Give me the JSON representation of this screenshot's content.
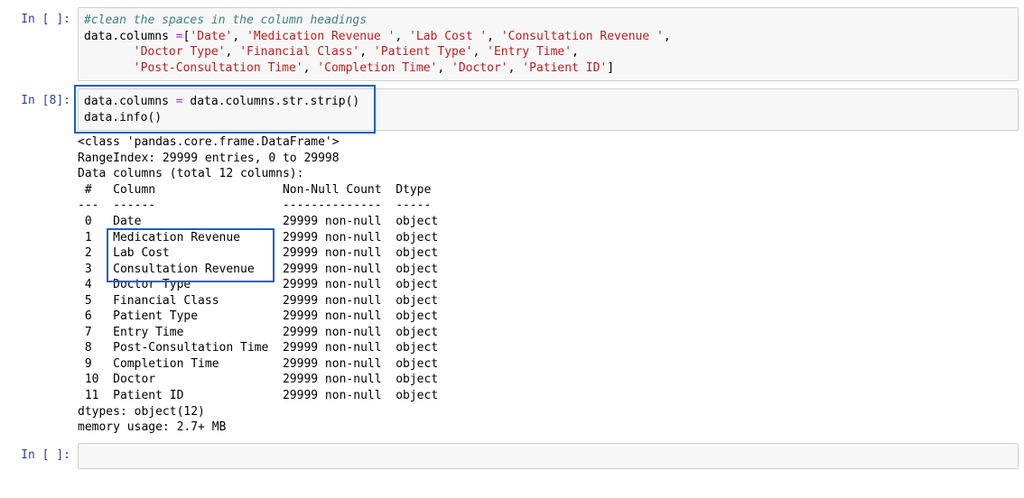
{
  "cell1": {
    "prompt": "In [ ]:",
    "code": {
      "comment": "#clean the spaces in the column headings",
      "assign_prefix": "data.columns =[",
      "cols_line1": [
        "'Date'",
        "'Medication Revenue '",
        "'Lab Cost '",
        "'Consultation Revenue '"
      ],
      "cols_line2": [
        "'Doctor Type'",
        "'Financial Class'",
        "'Patient Type'",
        "'Entry Time'"
      ],
      "cols_line3": [
        "'Post-Consultation Time'",
        "'Completion Time'",
        "'Doctor'",
        "'Patient ID'"
      ],
      "suffix": "]"
    }
  },
  "cell2": {
    "prompt": "In [8]:",
    "code": {
      "line1_prefix": "data.columns ",
      "line1_eq": "= ",
      "line1_rhs": "data.columns.str.strip()",
      "line2": "data.info()"
    },
    "output": {
      "header1": "<class 'pandas.core.frame.DataFrame'>",
      "header2": "RangeIndex: 29999 entries, 0 to 29998",
      "header3": "Data columns (total 12 columns):",
      "col_head": " #   Column                  Non-Null Count  Dtype ",
      "col_div": "---  ------                  --------------  ----- ",
      "rows": [
        " 0   Date                    29999 non-null  object",
        " 1   Medication Revenue      29999 non-null  object",
        " 2   Lab Cost                29999 non-null  object",
        " 3   Consultation Revenue    29999 non-null  object",
        " 4   Doctor Type             29999 non-null  object",
        " 5   Financial Class         29999 non-null  object",
        " 6   Patient Type            29999 non-null  object",
        " 7   Entry Time              29999 non-null  object",
        " 8   Post-Consultation Time  29999 non-null  object",
        " 9   Completion Time         29999 non-null  object",
        " 10  Doctor                  29999 non-null  object",
        " 11  Patient ID              29999 non-null  object"
      ],
      "footer1": "dtypes: object(12)",
      "footer2": "memory usage: 2.7+ MB"
    }
  },
  "cell3": {
    "prompt": "In [ ]:",
    "code": " "
  },
  "punct": {
    "comma_sp": ", "
  }
}
